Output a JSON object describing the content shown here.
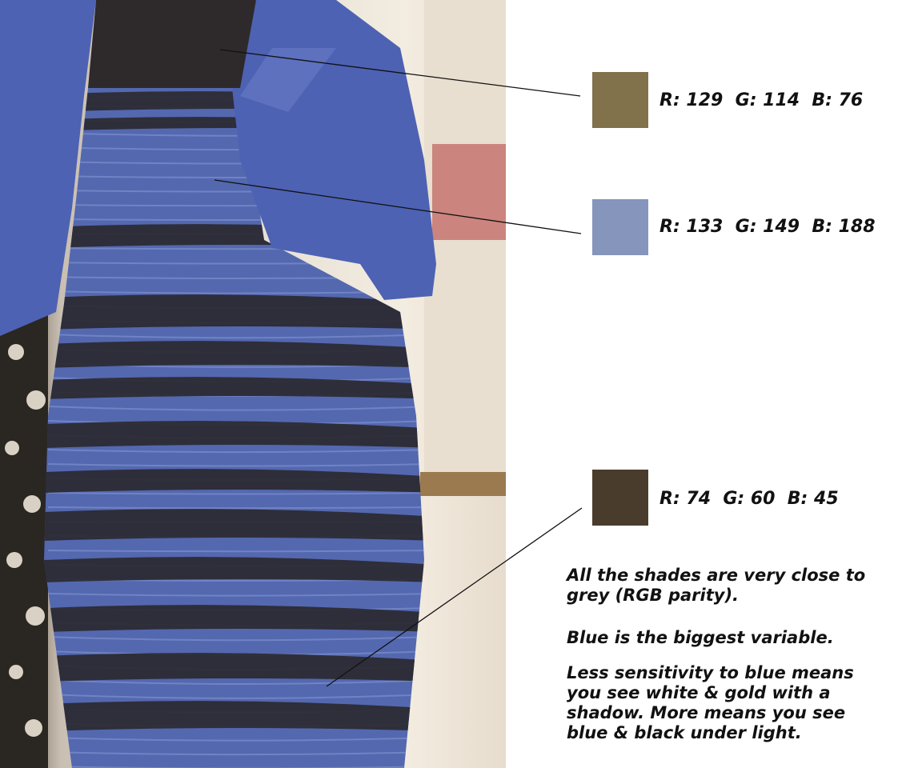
{
  "swatches": [
    {
      "label": "R: 129  G: 114  B: 76",
      "color": "#81724C"
    },
    {
      "label": "R: 133  G: 149  B: 188",
      "color": "#8595BC"
    },
    {
      "label": "R: 74  G: 60  B: 45",
      "color": "#4A3C2D"
    }
  ],
  "notes": {
    "line1": "All the shades are very close to grey (RGB parity).",
    "line2": "Blue is the biggest variable.",
    "line3": "Less sensitivity to blue means you see white & gold with a shadow. More means you see blue & black under light."
  },
  "colors": {
    "dress_blue": "#5468b0",
    "lace_black": "#2b2a30",
    "jacket_blue": "#4d62b3",
    "pointer_line": "#111111"
  }
}
